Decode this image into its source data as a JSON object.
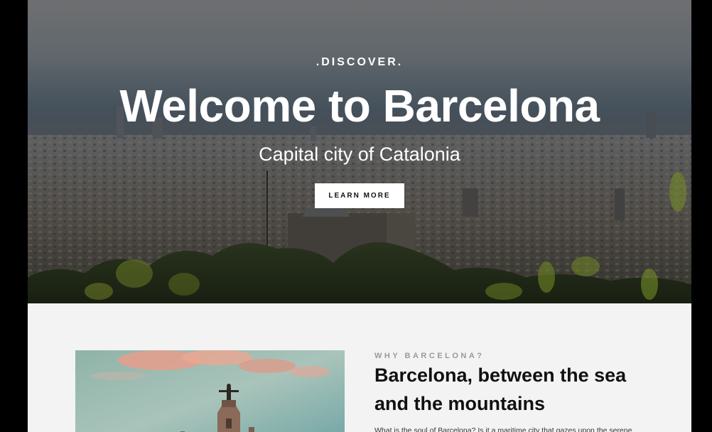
{
  "hero": {
    "kicker": ".DISCOVER.",
    "title": "Welcome to Barcelona",
    "subtitle": "Capital city of Catalonia",
    "button_label": "LEARN MORE"
  },
  "about": {
    "kicker": "WHY BARCELONA?",
    "heading": "Barcelona, between the sea and the mountains",
    "text": "What is the soul of Barcelona? Is it a maritime city that gazes upon the serene"
  },
  "colors": {
    "page_background": "#f3f3f3",
    "outer_background": "#000000",
    "button_background": "#ffffff"
  }
}
